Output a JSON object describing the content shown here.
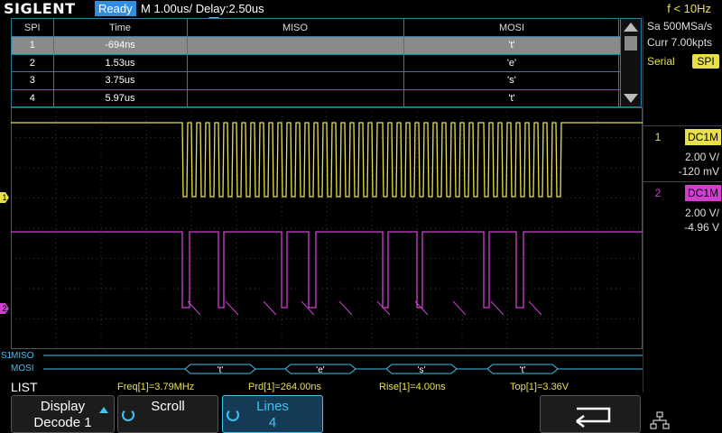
{
  "topbar": {
    "logo": "SIGLENT",
    "status": "Ready",
    "timebase": "M 1.00us/  Delay:2.50us",
    "trigger_freq": "f < 10Hz"
  },
  "decode_table": {
    "headers": [
      "SPI",
      "Time",
      "MISO",
      "MOSI"
    ],
    "rows": [
      {
        "idx": "1",
        "time": "-694ns",
        "miso": "",
        "mosi": "'t'"
      },
      {
        "idx": "2",
        "time": "1.53us",
        "miso": "",
        "mosi": "'e'"
      },
      {
        "idx": "3",
        "time": "3.75us",
        "miso": "",
        "mosi": "'s'"
      },
      {
        "idx": "4",
        "time": "5.97us",
        "miso": "",
        "mosi": "'t'"
      }
    ]
  },
  "acquisition": {
    "sample_rate": "Sa 500MSa/s",
    "memory": "Curr 7.00kpts",
    "serial_label": "Serial",
    "serial_protocol": "SPI"
  },
  "channels": [
    {
      "num": "1",
      "coupling": "DC1M",
      "vdiv": "2.00 V/",
      "offset": "-120 mV",
      "color": "#e8e04a"
    },
    {
      "num": "2",
      "coupling": "DC1M",
      "vdiv": "2.00 V/",
      "offset": "-4.96 V",
      "color": "#d040d0"
    }
  ],
  "bus": {
    "s1_label": "S1",
    "miso_label": "MISO",
    "mosi_label": "MOSI",
    "mosi_packets": [
      "'t'",
      "'e'",
      "'s'",
      "'t'"
    ]
  },
  "measurements": {
    "list_label": "LIST",
    "freq": "Freq[1]=3.79MHz",
    "prd": "Prd[1]=264.00ns",
    "rise": "Rise[1]=4.00ns",
    "top": "Top[1]=3.36V"
  },
  "softkeys": {
    "display_l1": "Display",
    "display_l2": "Decode 1",
    "scroll": "Scroll",
    "lines_l1": "Lines",
    "lines_l2": "4"
  },
  "colors": {
    "ch1": "#e8e04a",
    "ch2": "#d040d0",
    "accent": "#3ec3f0"
  }
}
